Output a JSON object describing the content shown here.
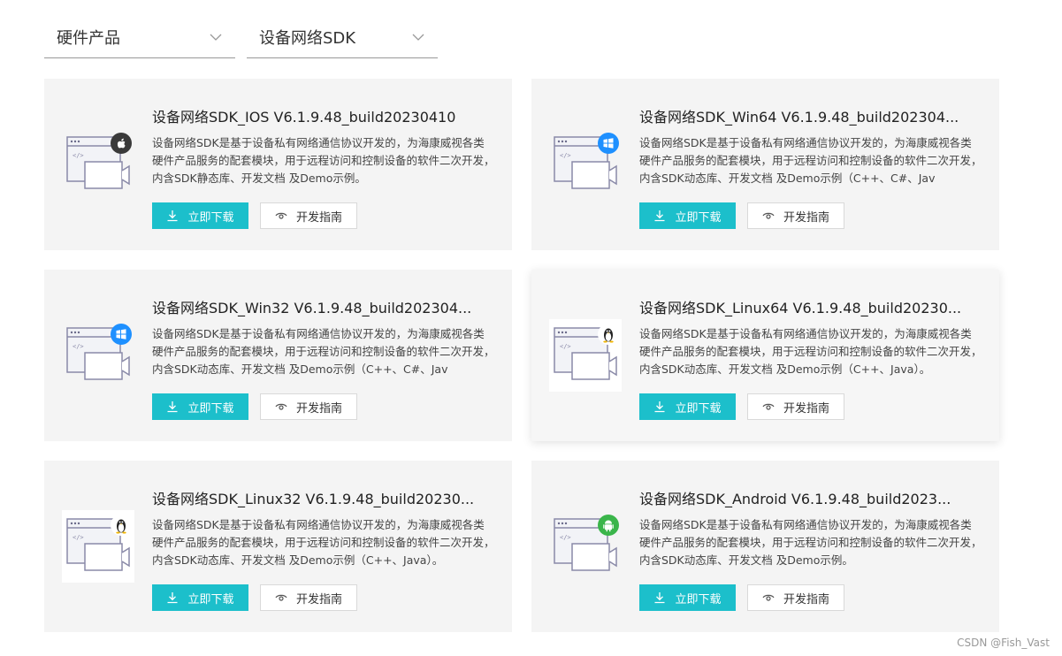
{
  "filters": [
    {
      "label": "硬件产品"
    },
    {
      "label": "设备网络SDK"
    }
  ],
  "cards": [
    {
      "title": "设备网络SDK_IOS V6.1.9.48_build20230410",
      "description": "设备网络SDK是基于设备私有网络通信协议开发的，为海康威视各类硬件产品服务的配套模块，用于远程访问和控制设备的软件二次开发，内含SDK静态库、开发文档 及Demo示例。",
      "platform_icon": "apple-icon",
      "download_label": "立即下载",
      "guide_label": "开发指南"
    },
    {
      "title": "设备网络SDK_Win64 V6.1.9.48_build202304...",
      "description": "设备网络SDK是基于设备私有网络通信协议开发的，为海康威视各类硬件产品服务的配套模块，用于远程访问和控制设备的软件二次开发，内含SDK动态库、开发文档 及Demo示例（C++、C#、Jav",
      "platform_icon": "windows-icon",
      "download_label": "立即下载",
      "guide_label": "开发指南"
    },
    {
      "title": "设备网络SDK_Win32 V6.1.9.48_build202304...",
      "description": "设备网络SDK是基于设备私有网络通信协议开发的，为海康威视各类硬件产品服务的配套模块，用于远程访问和控制设备的软件二次开发，内含SDK动态库、开发文档 及Demo示例（C++、C#、Jav",
      "platform_icon": "windows-icon",
      "download_label": "立即下载",
      "guide_label": "开发指南"
    },
    {
      "title": "设备网络SDK_Linux64 V6.1.9.48_build20230...",
      "description": "设备网络SDK是基于设备私有网络通信协议开发的，为海康威视各类硬件产品服务的配套模块，用于远程访问和控制设备的软件二次开发，内含SDK动态库、开发文档 及Demo示例（C++、Java）。",
      "platform_icon": "linux-icon",
      "download_label": "立即下载",
      "guide_label": "开发指南"
    },
    {
      "title": "设备网络SDK_Linux32 V6.1.9.48_build20230...",
      "description": "设备网络SDK是基于设备私有网络通信协议开发的，为海康威视各类硬件产品服务的配套模块，用于远程访问和控制设备的软件二次开发，内含SDK动态库、开发文档 及Demo示例（C++、Java）。",
      "platform_icon": "linux-icon",
      "download_label": "立即下载",
      "guide_label": "开发指南"
    },
    {
      "title": "设备网络SDK_Android V6.1.9.48_build2023...",
      "description": "设备网络SDK是基于设备私有网络通信协议开发的，为海康威视各类硬件产品服务的配套模块，用于远程访问和控制设备的软件二次开发，内含SDK动态库、开发文档 及Demo示例。",
      "platform_icon": "android-icon",
      "download_label": "立即下载",
      "guide_label": "开发指南"
    }
  ],
  "colors": {
    "accent": "#1cbfcb",
    "card_bg": "#f4f4f4",
    "apple_badge": "#333333",
    "windows_badge": "#1e90ff",
    "android_badge": "#3ab54a"
  },
  "watermark": "CSDN @Fish_Vast"
}
